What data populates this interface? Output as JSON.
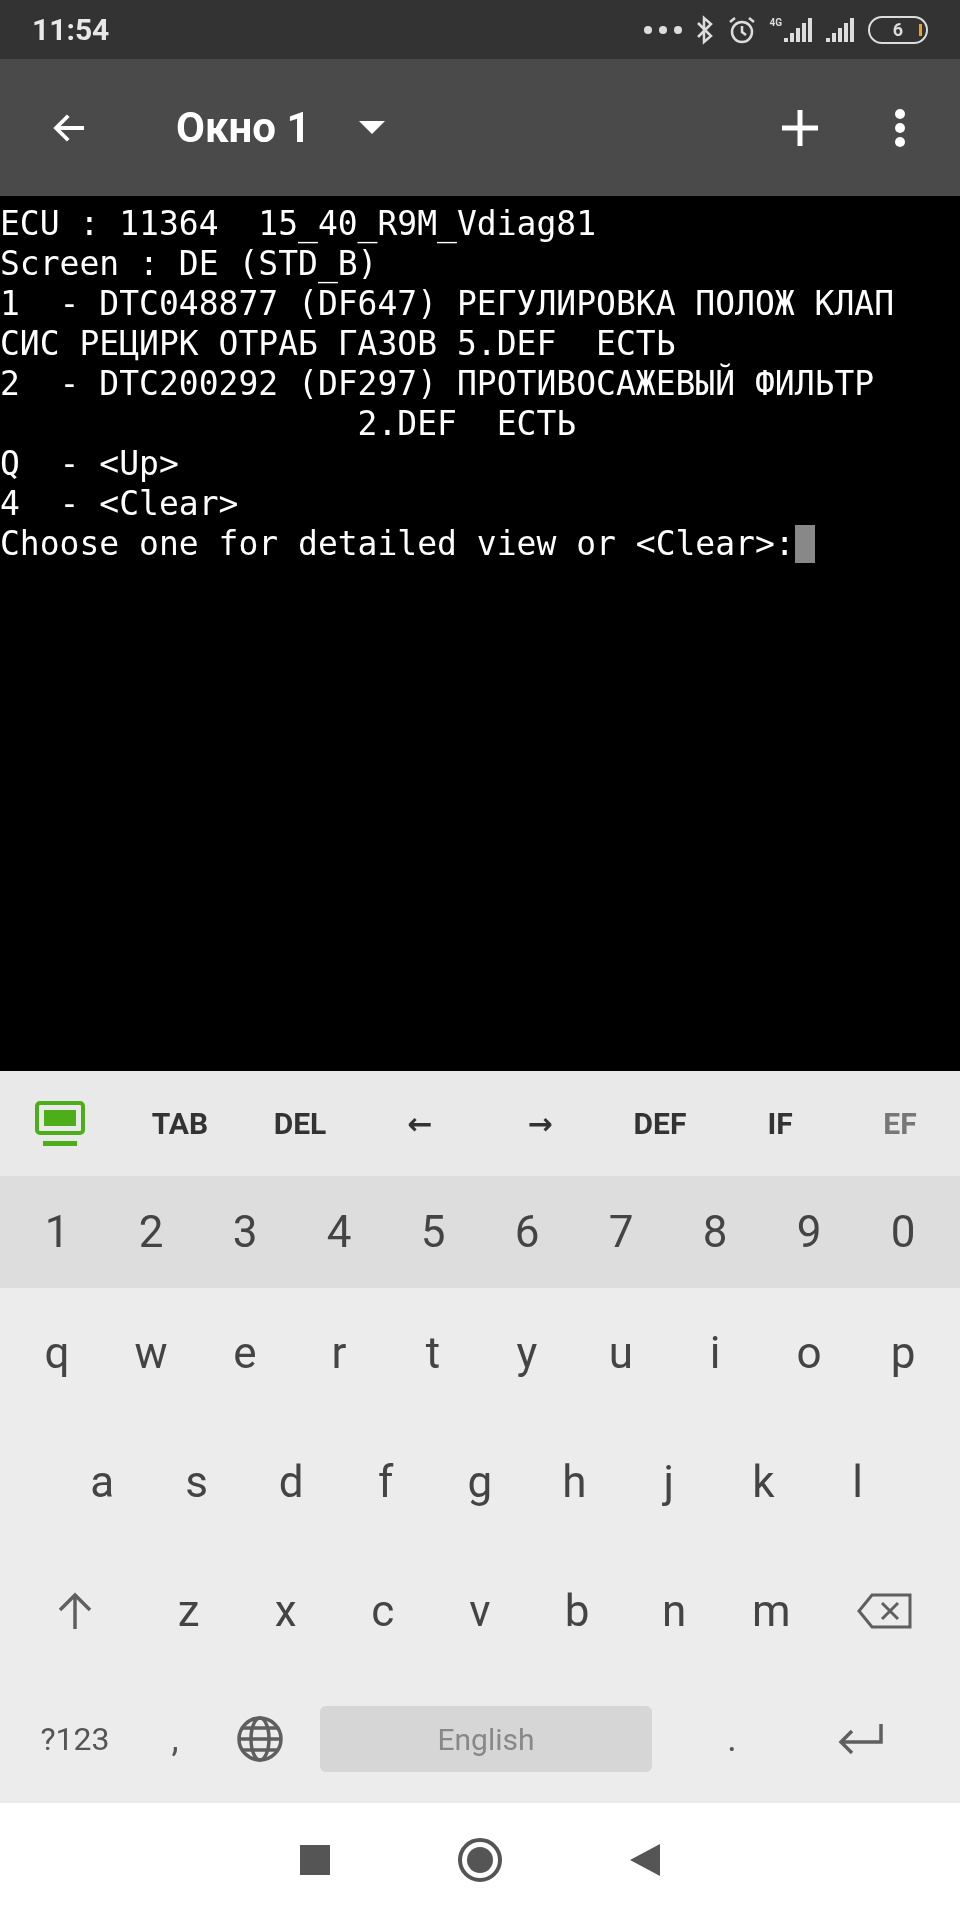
{
  "status_bar": {
    "time": "11:54",
    "battery": "6",
    "network": "4G"
  },
  "toolbar": {
    "title": "Окно 1"
  },
  "terminal": {
    "lines": [
      "ECU : 11364  15_40_R9M_Vdiag81",
      "Screen : DE (STD_B)",
      "1  - DTC048877 (DF647) РЕГУЛИРОВКА ПОЛОЖ КЛАП",
      "СИС РЕЦИРК ОТРАБ ГАЗОВ 5.DEF  ЕСТЬ",
      "2  - DTC200292 (DF297) ПРОТИВОСАЖЕВЫЙ ФИЛЬТР",
      "                  2.DEF  ЕСТЬ",
      "Q  - <Up>",
      "4  - <Clear>",
      "Choose one for detailed view or <Clear>:"
    ]
  },
  "extra_keys": [
    {
      "kind": "icon"
    },
    {
      "kind": "text",
      "label": "TAB"
    },
    {
      "kind": "text",
      "label": "DEL"
    },
    {
      "kind": "text",
      "label": "←"
    },
    {
      "kind": "text",
      "label": "→"
    },
    {
      "kind": "text",
      "label": "DEF"
    },
    {
      "kind": "text",
      "label": "IF"
    },
    {
      "kind": "text",
      "label": "EF"
    }
  ],
  "keyboard": {
    "number_row": [
      "1",
      "2",
      "3",
      "4",
      "5",
      "6",
      "7",
      "8",
      "9",
      "0"
    ],
    "rows": [
      [
        "q",
        "w",
        "e",
        "r",
        "t",
        "y",
        "u",
        "i",
        "o",
        "p"
      ],
      [
        "a",
        "s",
        "d",
        "f",
        "g",
        "h",
        "j",
        "k",
        "l"
      ],
      [
        "z",
        "x",
        "c",
        "v",
        "b",
        "n",
        "m"
      ]
    ],
    "symbols_key": "?123",
    "comma_key": ",",
    "space_label": "English",
    "period_key": "."
  }
}
